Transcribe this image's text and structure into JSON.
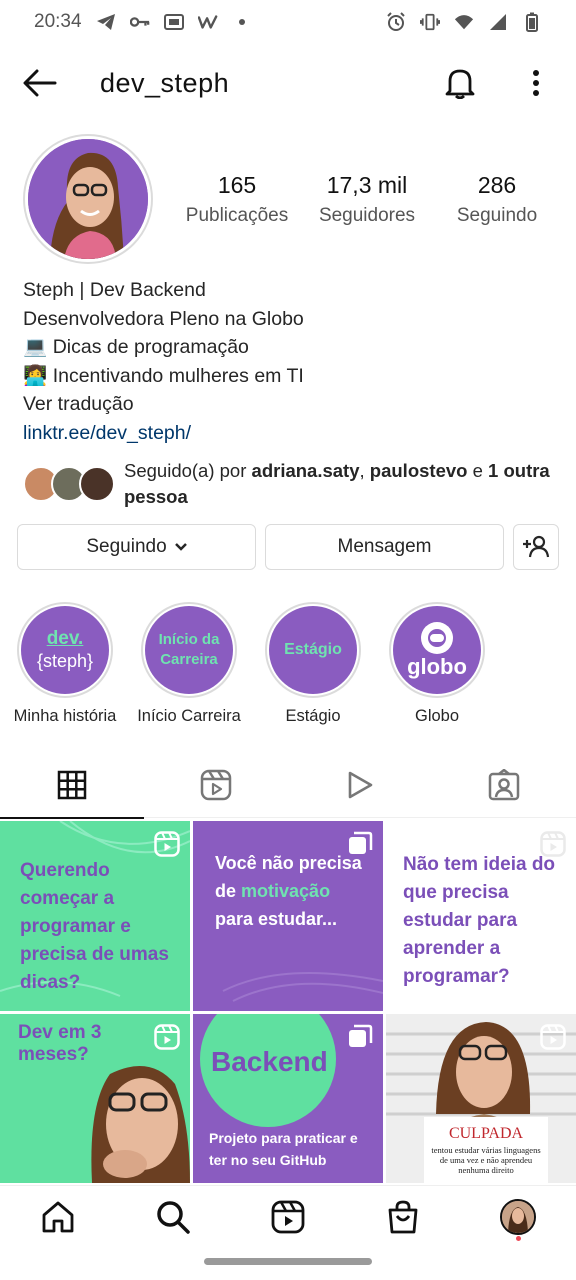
{
  "status_bar": {
    "time": "20:34",
    "left_icons": [
      "telegram-icon",
      "key-icon",
      "slides-icon",
      "w-icon",
      "dot-icon"
    ],
    "right_icons": [
      "alarm-icon",
      "vibrate-icon",
      "wifi-icon",
      "signal-icon",
      "battery-icon"
    ]
  },
  "header": {
    "username": "dev_steph"
  },
  "profile": {
    "stats": [
      {
        "value": "165",
        "label": "Publicações"
      },
      {
        "value": "17,3 mil",
        "label": "Seguidores"
      },
      {
        "value": "286",
        "label": "Seguindo"
      }
    ],
    "bio_lines": [
      "Steph | Dev Backend",
      "Desenvolvedora Pleno na Globo",
      "💻 Dicas de programação",
      "👩‍💻 Incentivando mulheres em TI"
    ],
    "see_translation": "Ver tradução",
    "link": "linktr.ee/dev_steph/"
  },
  "followed_by": {
    "prefix": "Seguido(a) por ",
    "user1": "adriana.saty",
    "separator": ", ",
    "user2": "paulostevo",
    "connector": " e ",
    "others": "1 outra pessoa"
  },
  "buttons": {
    "following": "Seguindo",
    "message": "Mensagem"
  },
  "highlights": [
    {
      "label": "Minha história",
      "cover_line1": "dev.",
      "cover_line2": "{steph}"
    },
    {
      "label": "Início Carreira",
      "cover_line1": "Início da",
      "cover_line2": "Carreira"
    },
    {
      "label": "Estágio",
      "cover_line1": "Estágio",
      "cover_line2": ""
    },
    {
      "label": "Globo",
      "cover_line1": "globo",
      "cover_line2": ""
    }
  ],
  "tabs": [
    "grid-icon",
    "reels-icon",
    "play-icon",
    "tagged-icon"
  ],
  "posts": [
    {
      "text": "Querendo começar a programar e precisa de umas dicas?",
      "bg": "#5fe0a0",
      "color": "#7b4fb8"
    },
    {
      "text_a": "Você não precisa de",
      "text_b": "motivação",
      "text_c": "para estudar...",
      "bg": "#8a5cc0",
      "color": "#ffffff"
    },
    {
      "text": "Não tem ideia do que precisa estudar para aprender a programar?",
      "bg": "#ffffff",
      "color": "#7b4fb8"
    },
    {
      "text": "Dev em 3 meses?",
      "bg": "#5fe0a0",
      "color": "#7b4fb8"
    },
    {
      "title": "Backend",
      "subtitle": "Projeto para praticar e ter no seu GitHub",
      "bg": "#8a5cc0",
      "color": "#ffffff"
    },
    {
      "sign_title": "CULPADA",
      "sign_text": "tentou estudar várias linguagens de uma vez e não aprendeu nenhuma direito",
      "bg": "#eeeeee"
    }
  ],
  "colors": {
    "brand_purple": "#8a5cc0",
    "brand_green": "#5fe0a0",
    "link_blue": "#00376b"
  }
}
